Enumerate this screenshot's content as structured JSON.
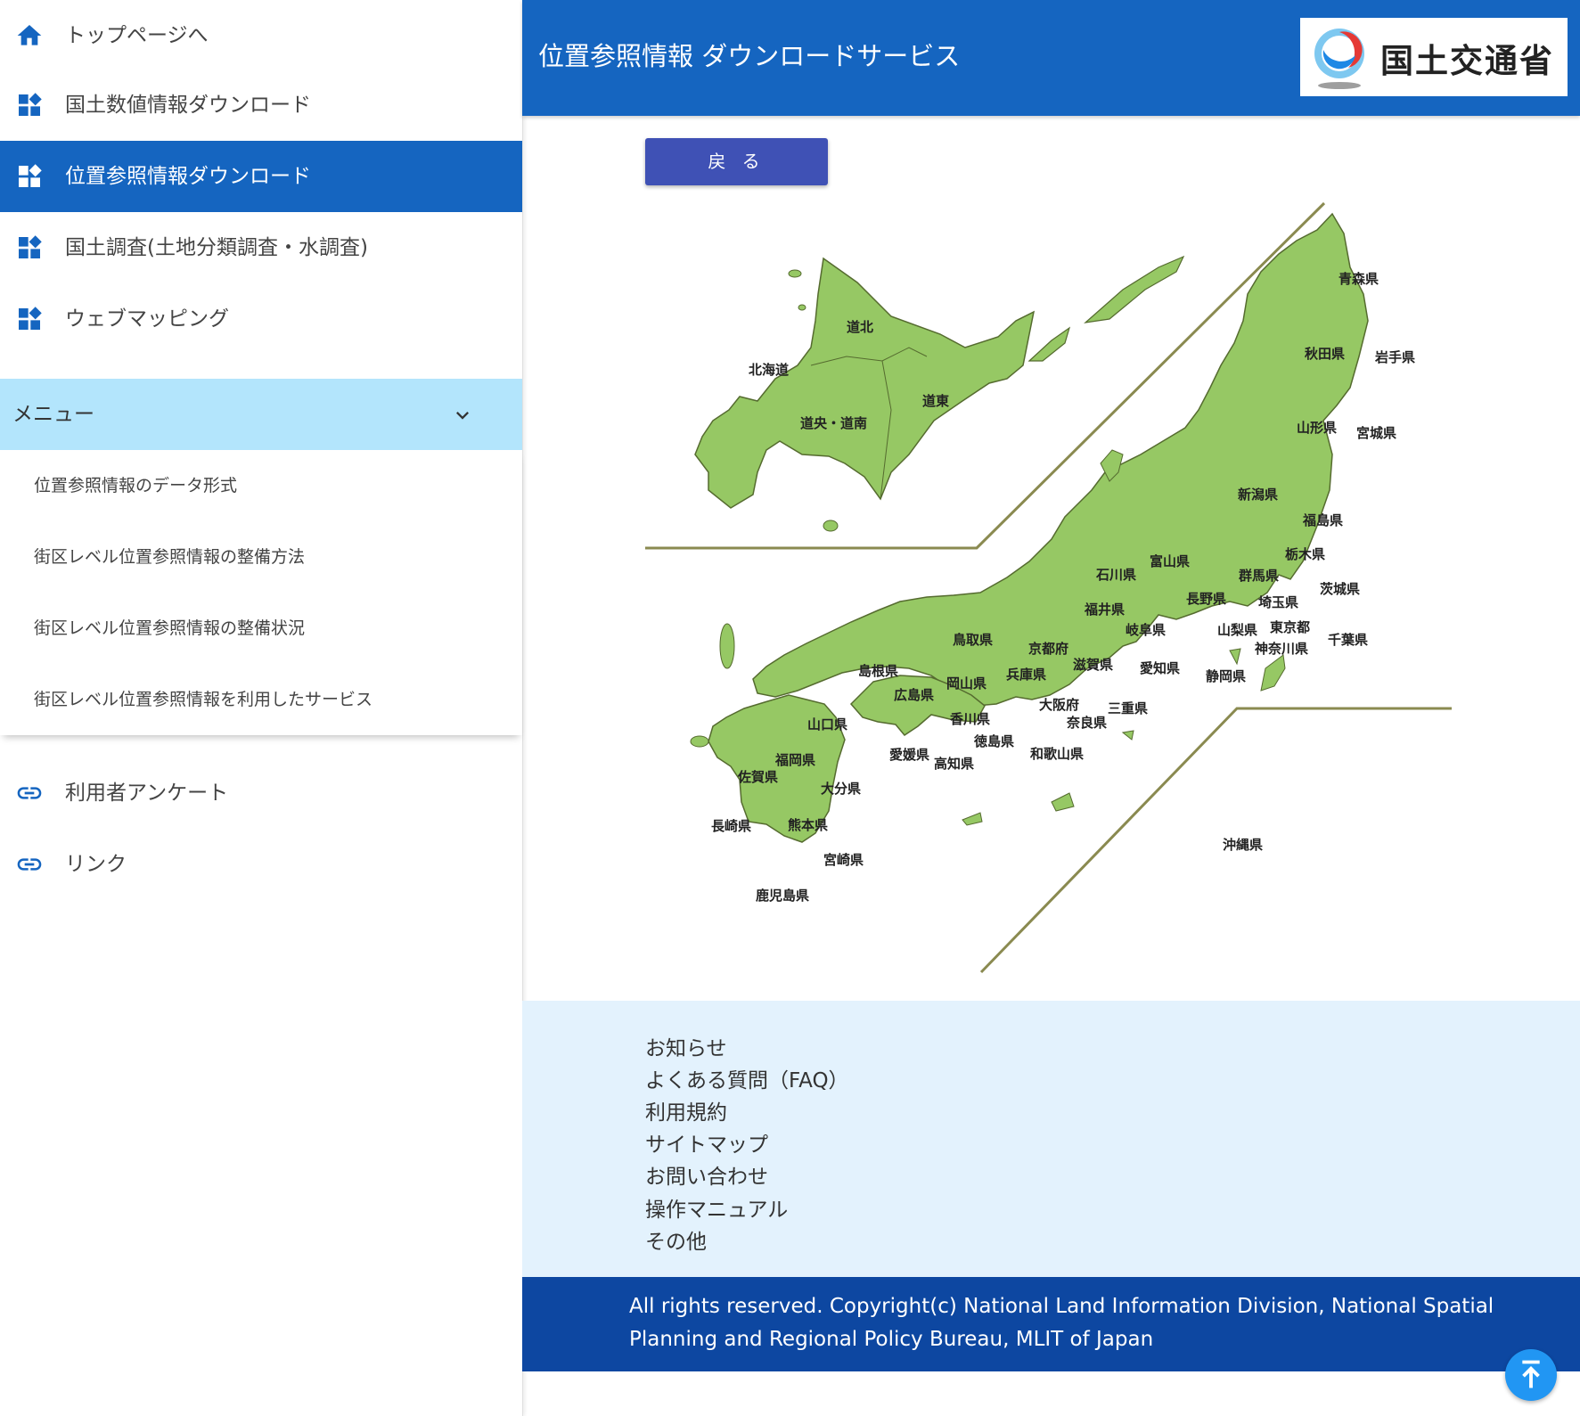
{
  "sidebar": {
    "nav": [
      {
        "label": "トップページへ",
        "icon": "home-icon"
      },
      {
        "label": "国土数値情報ダウンロード",
        "icon": "dashboard-icon"
      },
      {
        "label": "位置参照情報ダウンロード",
        "icon": "dashboard-icon",
        "active": true
      },
      {
        "label": "国土調査(土地分類調査・水調査)",
        "icon": "dashboard-icon"
      },
      {
        "label": "ウェブマッピング",
        "icon": "dashboard-icon"
      }
    ],
    "menu": {
      "label": "メニュー",
      "items": [
        "位置参照情報のデータ形式",
        "街区レベル位置参照情報の整備方法",
        "街区レベル位置参照情報の整備状況",
        "街区レベル位置参照情報を利用したサービス"
      ]
    },
    "links": [
      {
        "label": "利用者アンケート",
        "icon": "link-icon"
      },
      {
        "label": "リンク",
        "icon": "link-icon"
      }
    ]
  },
  "header": {
    "title": "位置参照情報 ダウンロードサービス",
    "logo_text": "国土交通省"
  },
  "back_button": "戻 る",
  "map": {
    "hokkaido": [
      "北海道",
      "道北",
      "道東",
      "道央・道南"
    ],
    "prefectures": [
      "青森県",
      "秋田県",
      "岩手県",
      "山形県",
      "宮城県",
      "新潟県",
      "福島県",
      "栃木県",
      "富山県",
      "石川県",
      "群馬県",
      "茨城県",
      "長野県",
      "埼玉県",
      "福井県",
      "岐阜県",
      "山梨県",
      "東京都",
      "千葉県",
      "鳥取県",
      "京都府",
      "神奈川県",
      "島根県",
      "兵庫県",
      "滋賀県",
      "愛知県",
      "岡山県",
      "静岡県",
      "広島県",
      "大阪府",
      "三重県",
      "山口県",
      "香川県",
      "奈良県",
      "徳島県",
      "愛媛県",
      "和歌山県",
      "福岡県",
      "高知県",
      "佐賀県",
      "大分県",
      "長崎県",
      "熊本県",
      "宮崎県",
      "鹿児島県",
      "沖縄県"
    ],
    "colors": {
      "land": "#96c864",
      "border": "#556b2f",
      "divider": "#8a8a50"
    }
  },
  "footer": {
    "links": [
      "お知らせ",
      "よくある質問（FAQ）",
      "利用規約",
      "サイトマップ",
      "お問い合わせ",
      "操作マニュアル",
      "その他"
    ],
    "copyright_line1": "All rights reserved. Copyright(c) National Land Information Division, National Spatial",
    "copyright_line2": "Planning and Regional Policy Bureau, MLIT of Japan"
  },
  "colors": {
    "primary": "#1565c0",
    "menu_bg": "#b3e5fc",
    "button": "#3f51b5",
    "footer_bg": "#e3f2fd",
    "copyright_bg": "#0d47a1"
  }
}
